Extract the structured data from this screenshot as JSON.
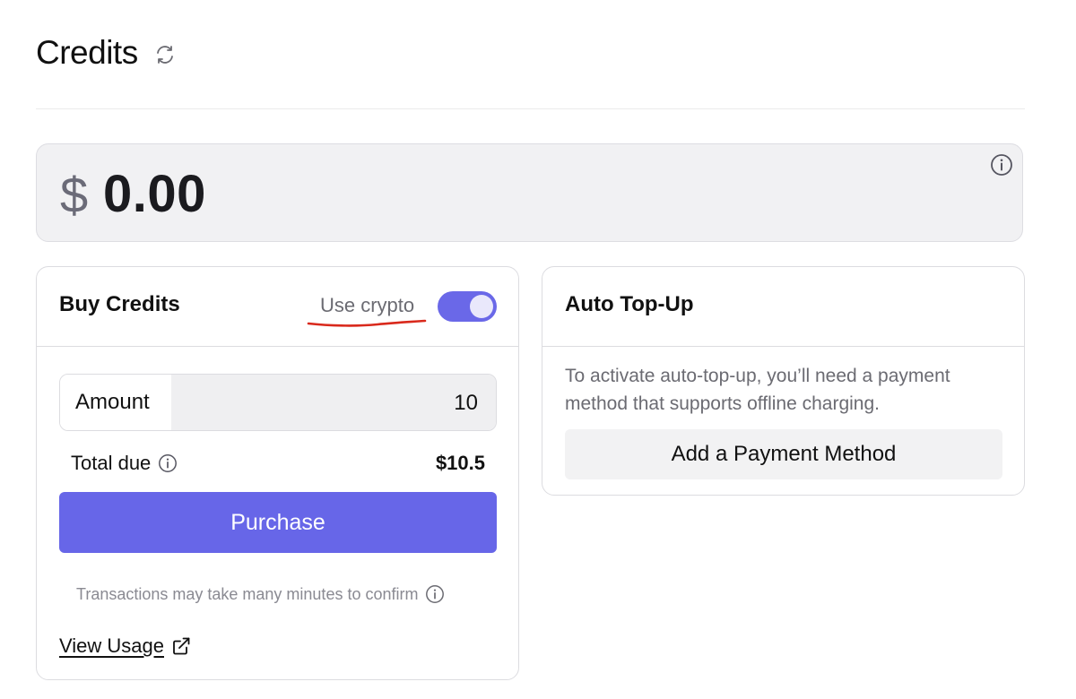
{
  "header": {
    "title": "Credits",
    "refresh_icon": "refresh-icon"
  },
  "balance": {
    "currency": "$",
    "amount": "0.00",
    "info_icon": "info-icon"
  },
  "buy_credits": {
    "title": "Buy Credits",
    "crypto_label": "Use crypto",
    "crypto_enabled": true,
    "amount_label": "Amount",
    "amount_value": "10",
    "total_label": "Total due",
    "total_value": "$10.5",
    "purchase_label": "Purchase",
    "note": "Transactions may take many minutes to confirm",
    "view_usage_label": "View Usage"
  },
  "auto_topup": {
    "title": "Auto Top-Up",
    "description": "To activate auto-top-up, you’ll need a payment method that supports offline charging.",
    "add_payment_label": "Add a Payment Method"
  },
  "colors": {
    "accent": "#6766e8",
    "annotation": "#d9291c",
    "balance_bg": "#f1f1f3"
  }
}
